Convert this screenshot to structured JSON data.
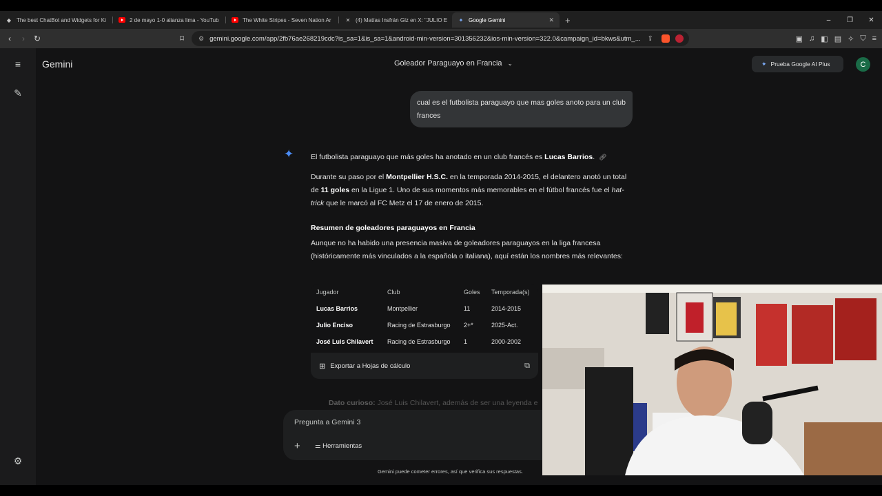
{
  "browser": {
    "tabs": [
      {
        "title": "The best ChatBot and Widgets for Ki",
        "icon": "gem-favicon-icon"
      },
      {
        "title": "2 de mayo 1-0 alianza lima - YouTub",
        "icon": "youtube-favicon-icon"
      },
      {
        "title": "The White Stripes - Seven Nation Ar",
        "icon": "youtube-favicon-icon"
      },
      {
        "title": "(4) Matías Insfrán Glz en X: \"JULIO E",
        "icon": "x-favicon-icon"
      },
      {
        "title": "Google Gemini",
        "icon": "gemini-favicon-icon"
      }
    ],
    "url": "gemini.google.com/app/2fb76ae268219cdc?is_sa=1&is_sa=1&android-min-version=301356232&ios-min-version=322.0&campaign_id=bkws&utm_..."
  },
  "app": {
    "brand": "Gemini",
    "conversation_title": "Goleador Paraguayo en Francia",
    "upgrade_button": "Prueba Google AI Plus",
    "avatar_letter": "C"
  },
  "chat": {
    "user_message": "cual es el futbolista paraguayo que mas goles anoto para un club frances",
    "response": {
      "p1_a": "El futbolista paraguayo que más goles ha anotado en un club francés es ",
      "p1_b": "Lucas Barrios",
      "p1_c": ".",
      "p2_a": "Durante su paso por el ",
      "p2_b": "Montpellier H.S.C.",
      "p2_c": " en la temporada 2014-2015, el delantero anotó un total de ",
      "p2_d": "11 goles",
      "p2_e": " en la Ligue 1. Uno de sus momentos más memorables en el fútbol francés fue el ",
      "p2_f": "hat-trick",
      "p2_g": " que le marcó al FC Metz el 17 de enero de 2015.",
      "heading": "Resumen de goleadores paraguayos en Francia",
      "p3": "Aunque no ha habido una presencia masiva de goleadores paraguayos en la liga francesa (históricamente más vinculados a la española o italiana), aquí están los nombres más relevantes:",
      "table": {
        "headers": [
          "Jugador",
          "Club",
          "Goles",
          "Temporada(s)"
        ],
        "rows": [
          [
            "Lucas Barrios",
            "Montpellier",
            "11",
            "2014-2015"
          ],
          [
            "Julio Enciso",
            "Racing de Estrasburgo",
            "2+*",
            "2025-Act."
          ],
          [
            "José Luis Chilavert",
            "Racing de Estrasburgo",
            "1",
            "2000-2002"
          ]
        ],
        "export_label": "Exportar a Hojas de cálculo"
      },
      "fun_fact_label": "Dato curioso:",
      "fun_fact_text": " José Luis Chilavert, además de ser una leyenda e"
    }
  },
  "composer": {
    "placeholder": "Pregunta a Gemini 3",
    "tools_label": "Herramientas"
  },
  "disclaimer": "Gemini puede cometer errores, así que verifica sus respuestas."
}
